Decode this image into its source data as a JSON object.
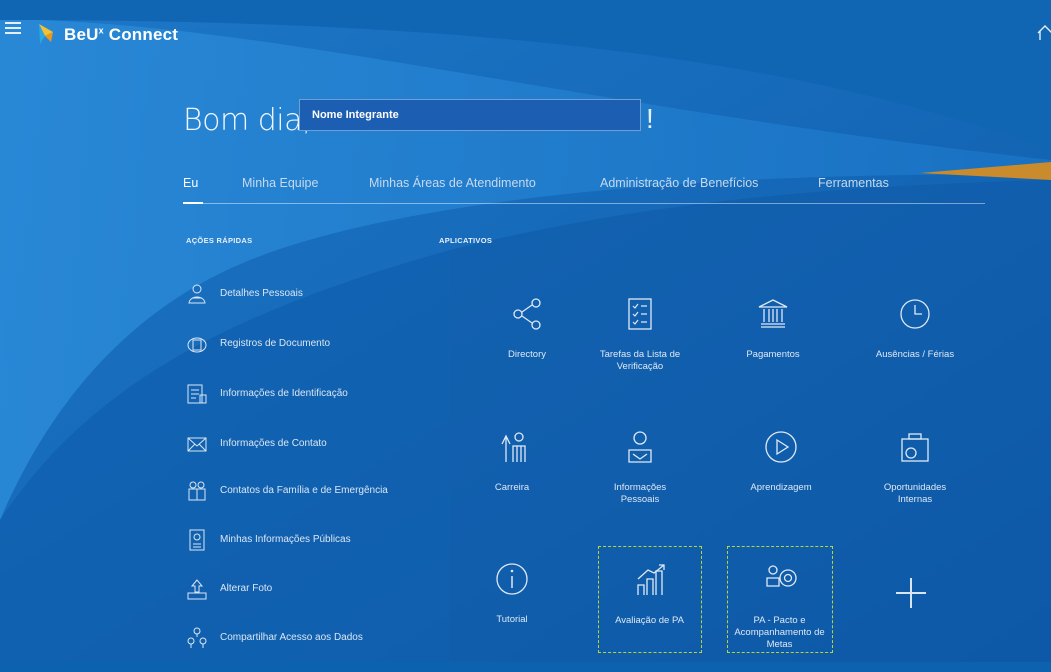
{
  "header": {
    "brand_prefix": "BeU",
    "brand_sup": "x",
    "brand_suffix": " Connect"
  },
  "greeting": {
    "text": "Bom dia,",
    "name": "Nome Integrante",
    "exclaim": "!"
  },
  "tabs": [
    {
      "label": "Eu",
      "active": true
    },
    {
      "label": "Minha Equipe"
    },
    {
      "label": "Minhas Áreas de Atendimento"
    },
    {
      "label": "Administração de Benefícios"
    },
    {
      "label": "Ferramentas"
    }
  ],
  "quick_actions": {
    "title": "AÇÕES RÁPIDAS",
    "items": [
      {
        "label": "Detalhes Pessoais",
        "icon": "person-icon"
      },
      {
        "label": "Registros de Documento",
        "icon": "document-record-icon"
      },
      {
        "label": "Informações de Identificação",
        "icon": "id-card-icon"
      },
      {
        "label": "Informações de Contato",
        "icon": "envelope-icon"
      },
      {
        "label": "Contatos da Família e de Emergência",
        "icon": "family-icon"
      },
      {
        "label": "Minhas Informações Públicas",
        "icon": "badge-icon"
      },
      {
        "label": "Alterar Foto",
        "icon": "upload-photo-icon"
      },
      {
        "label": "Compartilhar Acesso aos Dados",
        "icon": "share-access-icon"
      }
    ]
  },
  "apps": {
    "title": "APLICATIVOS",
    "items": [
      {
        "label": "Directory",
        "icon": "share-icon"
      },
      {
        "label": "Tarefas da Lista de Verificação",
        "icon": "checklist-icon"
      },
      {
        "label": "Pagamentos",
        "icon": "bank-icon"
      },
      {
        "label": "Ausências / Férias",
        "icon": "clock-icon"
      },
      {
        "label": "Carreira",
        "icon": "career-icon"
      },
      {
        "label": "Informações Pessoais",
        "icon": "personal-info-icon"
      },
      {
        "label": "Aprendizagem",
        "icon": "play-icon"
      },
      {
        "label": "Oportunidades Internas",
        "icon": "camera-icon"
      },
      {
        "label": "Tutorial",
        "icon": "info-icon"
      },
      {
        "label": "Avaliação de PA",
        "icon": "growth-chart-icon"
      },
      {
        "label": "PA - Pacto e Acompanhamento de Metas",
        "icon": "goals-icon"
      }
    ],
    "add_icon": "plus-icon"
  },
  "colors": {
    "bg_dark": "#0b4f98",
    "bg_light": "#1f7fd0",
    "highlight": "#b9d437",
    "accent_orange": "#c98b2b"
  }
}
